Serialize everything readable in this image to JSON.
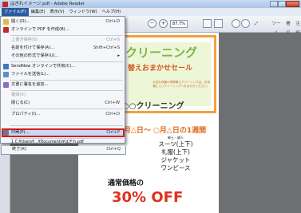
{
  "window": {
    "title": "はぎれイメージ.pdf - Adobe Reader"
  },
  "menubar": {
    "items": [
      "ファイル(F)",
      "編集(E)",
      "表示(V)",
      "ウィンドウ(W)",
      "ヘルプ(H)"
    ]
  },
  "toolbar": {
    "zoom": "87.7%",
    "tools_label": "ツール",
    "sign_label": "署名",
    "comment_label": "注釈"
  },
  "file_menu": {
    "items": [
      {
        "label": "開く(O)...",
        "shortcut": "Ctrl+O",
        "disabled": false,
        "icon": "open-folder-icon"
      },
      {
        "label": "オンラインで PDF を作成(B)...",
        "shortcut": "",
        "disabled": false,
        "icon": "create-pdf-icon"
      },
      {
        "label": "上書き保存(S)",
        "shortcut": "Ctrl+S",
        "disabled": true,
        "icon": ""
      },
      {
        "label": "名前を付けて保存(A)...",
        "shortcut": "Shift+Ctrl+S",
        "disabled": false,
        "icon": ""
      },
      {
        "label": "その他の形式で保存(U)...",
        "shortcut": "",
        "disabled": false,
        "icon": "",
        "submenu": true
      },
      {
        "label": "SendNow オンラインで共有(C)...",
        "shortcut": "",
        "disabled": false,
        "icon": "sendnow-icon"
      },
      {
        "label": "ファイルを送信(L)...",
        "shortcut": "",
        "disabled": false,
        "icon": "send-file-icon"
      },
      {
        "label": "文書に署名を追加...",
        "shortcut": "",
        "disabled": false,
        "icon": "sign-icon"
      },
      {
        "label": "復帰(V)",
        "shortcut": "",
        "disabled": true,
        "icon": ""
      },
      {
        "label": "閉じる(C)",
        "shortcut": "Ctrl+W",
        "disabled": false,
        "icon": ""
      },
      {
        "label": "プロパティ(I)...",
        "shortcut": "Ctrl+D",
        "disabled": false,
        "icon": ""
      },
      {
        "label": "印刷(P)...",
        "shortcut": "Ctrl+P",
        "disabled": false,
        "icon": "printer-icon",
        "highlighted": true
      },
      {
        "label": "1 C:¥Users¥...¥Documents¥はぎれ.pdf",
        "shortcut": "",
        "disabled": false,
        "icon": ""
      },
      {
        "label": "終了(X)",
        "shortcut": "Ctrl+Q",
        "disabled": false,
        "icon": ""
      }
    ]
  },
  "document": {
    "title": "クリーニング",
    "subtitle": "替えおまかせセール",
    "description": "大切な衣類の季節替えクリーニングは、お気軽に○○クリーニングへおまかせください。",
    "shop": "○○クリーニング",
    "period": "月△日〜 ○月△日の1週間",
    "note": "紳士・婦人",
    "items": [
      "スーツ(上下)",
      "礼服(上下)",
      "ジャケット",
      "ワンピース"
    ],
    "normal_price_label": "通常価格の",
    "discount": "30% OFF"
  },
  "colors": {
    "accent_green": "#7ab648",
    "accent_orange": "#f2a23b",
    "discount_red": "#e0301c",
    "highlight_red": "#d81c1c"
  }
}
